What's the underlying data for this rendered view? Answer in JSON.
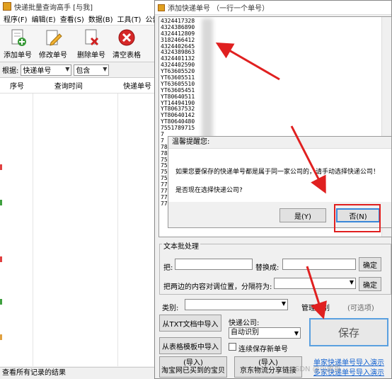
{
  "main_window": {
    "title": "快递批量查询高手 [与我]",
    "menu": [
      "程序(F)",
      "编辑(E)",
      "查看(S)",
      "数据(B)",
      "工具(T)",
      "公告(N"
    ],
    "toolbar": [
      {
        "label": "添加单号",
        "icon": "add-document-icon"
      },
      {
        "label": "修改单号",
        "icon": "edit-pencil-icon"
      },
      {
        "label": "删除单号",
        "icon": "delete-document-icon"
      },
      {
        "label": "清空表格",
        "icon": "clear-red-x-icon"
      }
    ],
    "filter": {
      "label": "根据:",
      "field": "快递单号",
      "mode": "包含"
    },
    "grid_headers": [
      "序号",
      "查询时间",
      "快递单号"
    ],
    "status": "查看所有记录的结果"
  },
  "add_dialog": {
    "title": "添加快递单号 （一行一个单号）",
    "numbers": [
      "4324417328",
      "4324386890",
      "4324412809",
      "3182466412",
      "4324402645",
      "4324389863",
      "4324401132",
      "4324402590",
      "YT63605520",
      "YT63605511",
      "YT63605510",
      "YT63605451",
      "YT80640511",
      "YT14494190",
      "YT80637532",
      "YT80640142",
      "YT80640480",
      "7551789715",
      "7",
      "7",
      "78",
      "78",
      "75",
      "75",
      "75",
      "75",
      "77",
      "77",
      "77",
      "77"
    ],
    "batch_group_title": "文本批处理",
    "replace_label": "把:",
    "replace_with_label": "替换成:",
    "swap_label": "把两边的内容对调位置，分隔符为:",
    "confirm_label": "确定",
    "category_label": "类别:",
    "category_manage_label": "管理类别",
    "optional_label": "(可选项)",
    "courier_label": "快递公司:",
    "courier_value": "自动识别",
    "auto_save_label": "连续保存新单号",
    "import_txt_label": "从TXT文档中导入",
    "import_template_label": "从表格模板中导入",
    "import_taobao_label": "(导入)\n淘宝网已买到的宝贝",
    "import_jd_label": "(导入)\n京东物流分享链接",
    "save_label": "保存",
    "bottom_link_line1": "单家快递单号导入演示",
    "bottom_link_line2": "多家快递单号导入演示"
  },
  "prompt": {
    "title": "温馨提醒您:",
    "line1": "如果您要保存的快递单号都是属于同一家公司的，请手动选择快递公司！",
    "line2": "是否现在选择快递公司?",
    "yes_label": "是(Y)",
    "no_label": "否(N)"
  },
  "watermark": "CSDN @小虎哥"
}
